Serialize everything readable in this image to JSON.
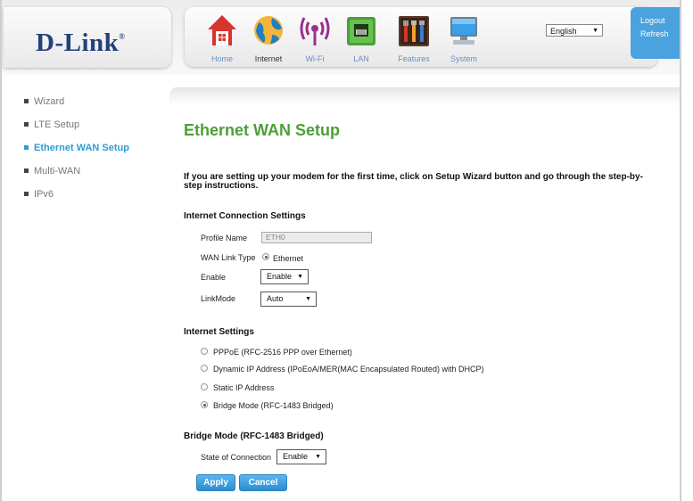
{
  "brand": {
    "name": "D-Link",
    "registered": "®"
  },
  "nav": {
    "items": [
      {
        "label": "Home",
        "icon": "home-icon"
      },
      {
        "label": "Internet",
        "icon": "globe-icon",
        "active": true
      },
      {
        "label": "Wi-Fi",
        "icon": "wifi-icon"
      },
      {
        "label": "LAN",
        "icon": "lan-icon"
      },
      {
        "label": "Features",
        "icon": "tools-icon"
      },
      {
        "label": "System",
        "icon": "computer-icon"
      }
    ]
  },
  "language": {
    "selected": "English"
  },
  "account": {
    "logout": "Logout",
    "refresh": "Refresh"
  },
  "sidebar": {
    "items": [
      {
        "label": "Wizard"
      },
      {
        "label": "LTE Setup"
      },
      {
        "label": "Ethernet WAN Setup",
        "active": true
      },
      {
        "label": "Multi-WAN"
      },
      {
        "label": "IPv6"
      }
    ]
  },
  "main": {
    "title": "Ethernet WAN Setup",
    "intro": "If you are setting up your modem for the first time, click on Setup Wizard button and go through the step-by-step instructions.",
    "connection_settings": {
      "title": "Internet Connection Settings",
      "profile_name_label": "Profile Name",
      "profile_name_value": "ETH0",
      "wan_link_type_label": "WAN Link Type",
      "wan_link_type_value": "Ethernet",
      "enable_label": "Enable",
      "enable_value": "Enable",
      "linkmode_label": "LinkMode",
      "linkmode_value": "Auto"
    },
    "internet_settings": {
      "title": "Internet Settings",
      "options": [
        {
          "label": "PPPoE (RFC-2516 PPP over Ethernet)",
          "selected": false
        },
        {
          "label": "Dynamic IP Address (IPoEoA/MER(MAC Encapsulated Routed) with DHCP)",
          "selected": false
        },
        {
          "label": "Static IP Address",
          "selected": false
        },
        {
          "label": "Bridge Mode (RFC-1483 Bridged)",
          "selected": true
        }
      ]
    },
    "bridge_mode": {
      "title": "Bridge Mode (RFC-1483 Bridged)",
      "state_label": "State of Connection",
      "state_value": "Enable"
    },
    "buttons": {
      "apply": "Apply",
      "cancel": "Cancel"
    }
  },
  "colors": {
    "accent_blue": "#2e9cd8",
    "title_green": "#4ba037",
    "brand_navy": "#24407a",
    "button_blue": "#3a9ee0"
  }
}
